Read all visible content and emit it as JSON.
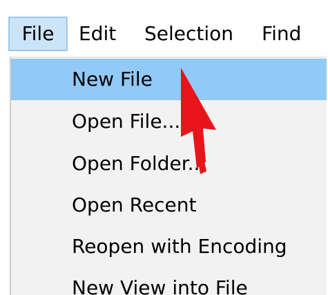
{
  "menubar": {
    "items": [
      {
        "label": "File",
        "active": true
      },
      {
        "label": "Edit",
        "active": false
      },
      {
        "label": "Selection",
        "active": false
      },
      {
        "label": "Find",
        "active": false
      }
    ]
  },
  "file_menu": {
    "highlighted": "New File",
    "items": [
      {
        "label": "New File"
      },
      {
        "label": "Open File..."
      },
      {
        "label": "Open Folder..."
      },
      {
        "label": "Open Recent"
      },
      {
        "label": "Reopen with Encoding"
      },
      {
        "label": "New View into File"
      }
    ]
  },
  "colors": {
    "highlight": "#91c9f7",
    "menubar_active_bg": "#cce4f7",
    "menubar_active_border": "#99c9ef",
    "dropdown_bg": "#f2f2f2",
    "annotation_arrow": "#e8141c"
  },
  "icons": {
    "annotation": "red-arrow-pointer-icon"
  }
}
